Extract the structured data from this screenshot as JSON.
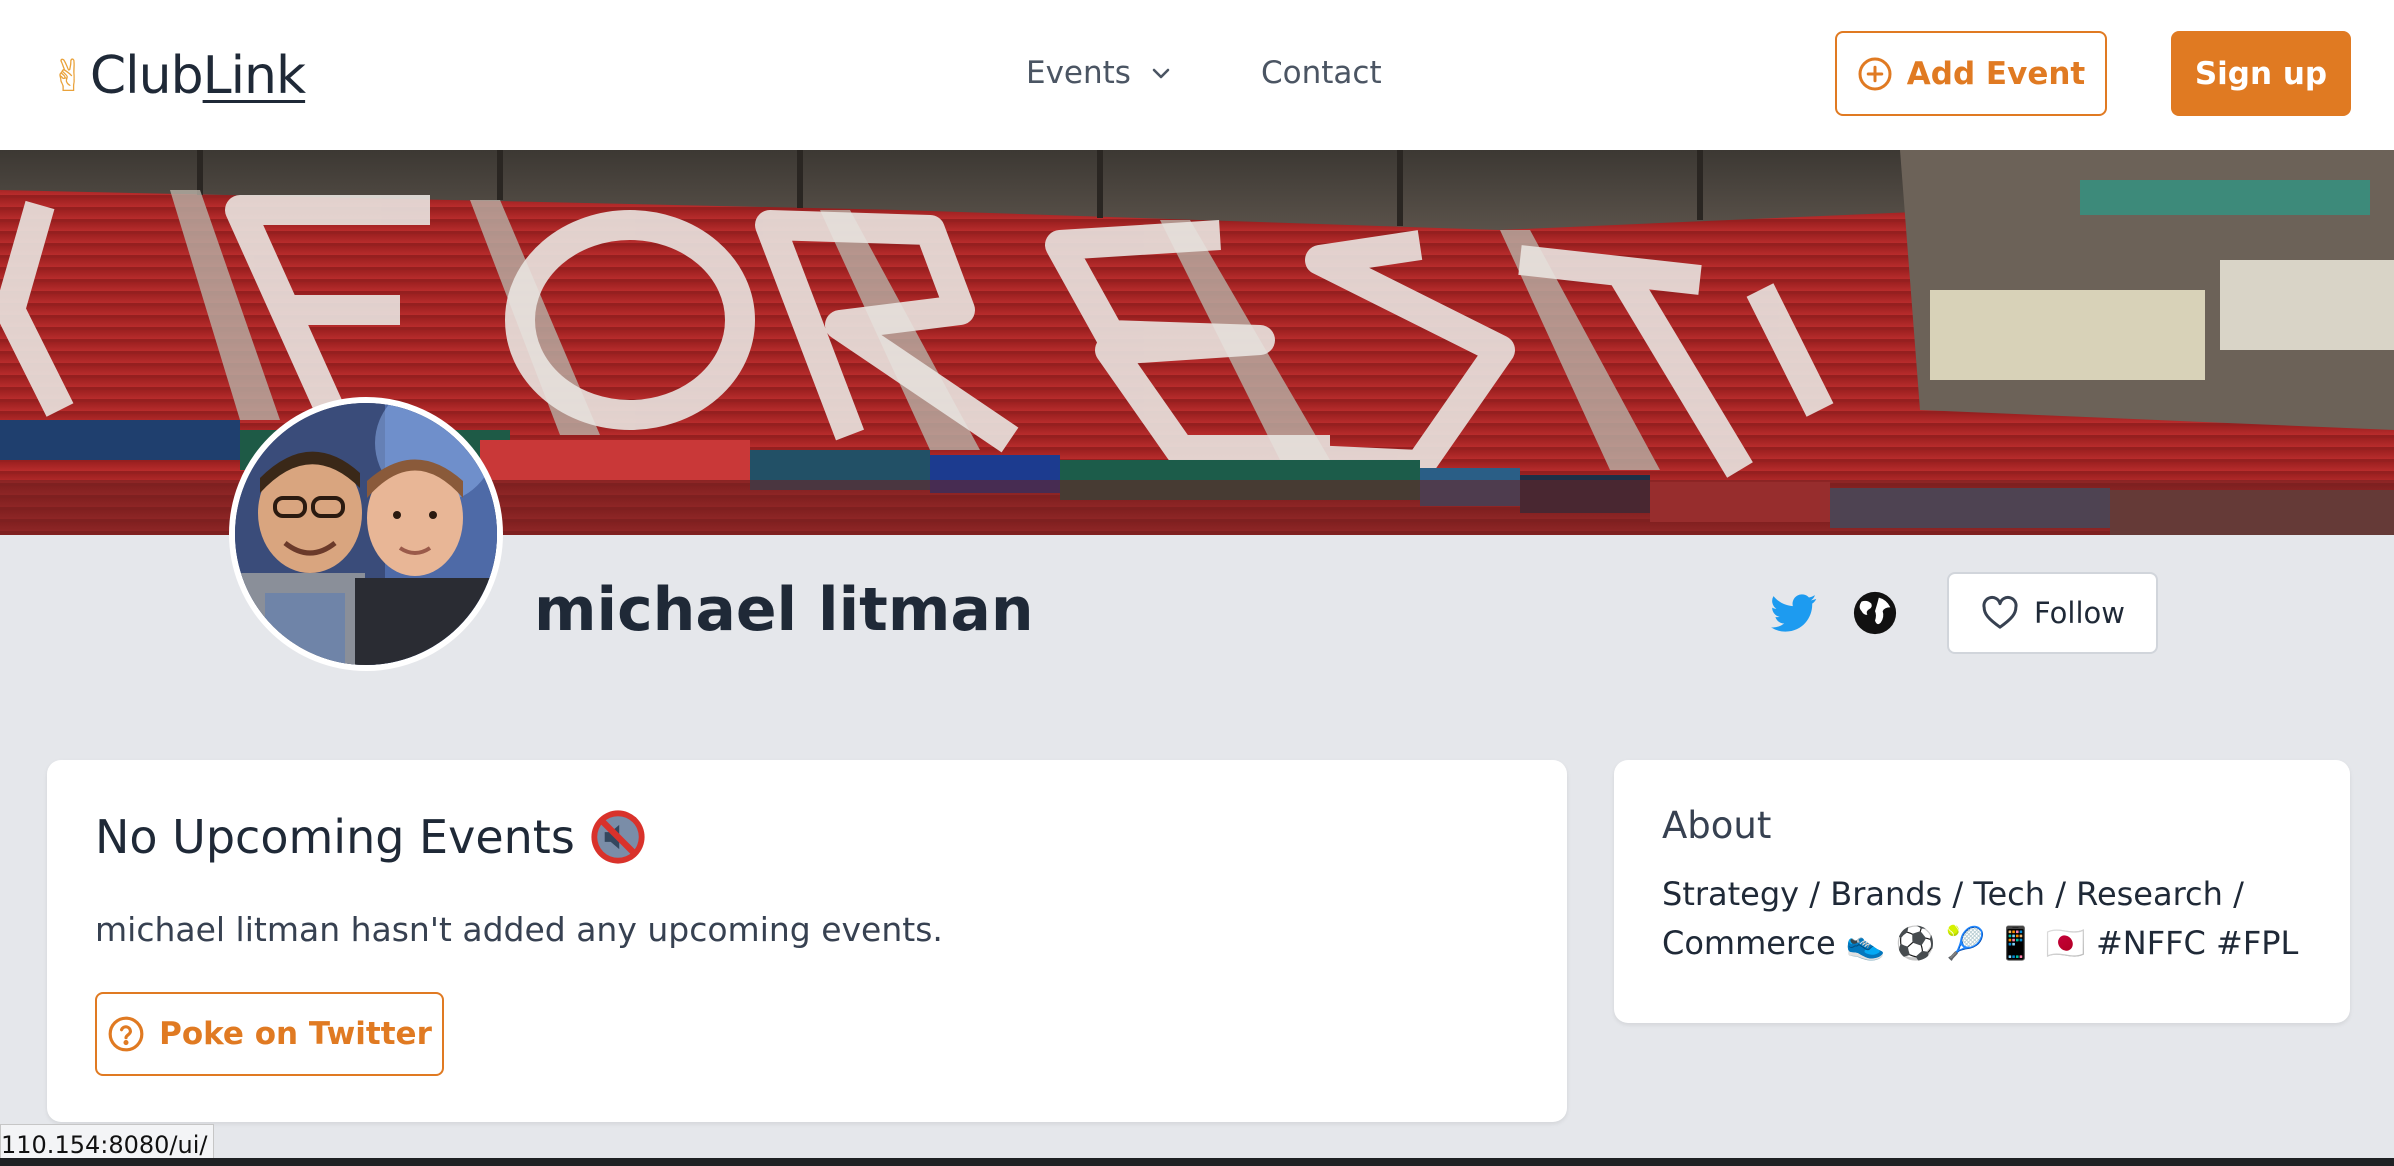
{
  "header": {
    "logo_text": "ClubLink",
    "logo_text_plain": "Club",
    "logo_text_underlined": "Link",
    "logo_icon": "victory-hand-emoji",
    "nav": {
      "events_label": "Events",
      "contact_label": "Contact"
    },
    "add_event_label": "Add Event",
    "signup_label": "Sign up"
  },
  "profile": {
    "name": "michael litman",
    "follow_label": "Follow",
    "social_icons": [
      "twitter-icon",
      "globe-icon"
    ]
  },
  "events": {
    "title": "No Upcoming Events",
    "title_icon": "muted-speaker-icon",
    "empty_text": "michael litman hasn't added any upcoming events.",
    "poke_label": "Poke on Twitter"
  },
  "about": {
    "title": "About",
    "text": "Strategy / Brands / Tech / Research / Commerce 👟 ⚽ 🎾 📱 🇯🇵 #NFFC #FPL"
  },
  "status_bar": {
    "url": "110.154:8080/ui/"
  },
  "colors": {
    "accent": "#e07a22",
    "page_bg": "#e5e7eb",
    "twitter": "#1d9bf0"
  }
}
